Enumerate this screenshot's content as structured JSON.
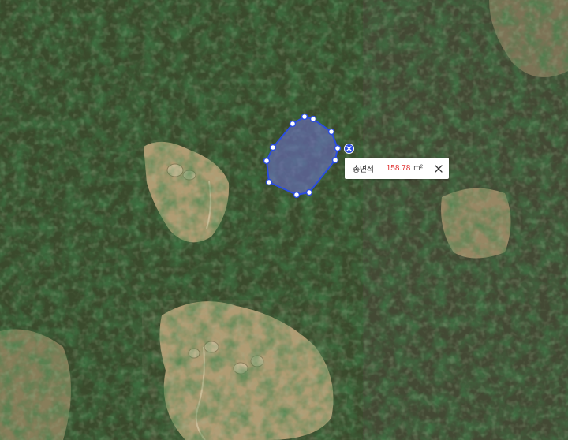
{
  "map": {
    "type": "satellite-imagery",
    "overlay": {
      "kind": "area-measurement-polygon",
      "stroke_color": "#2b4de0",
      "fill_color": "#6c6fc8",
      "vertex_count": 11
    }
  },
  "measurement": {
    "label": "총면적",
    "value": "158.78",
    "unit": "m²",
    "value_color": "#e03030"
  },
  "icons": {
    "close": "close-icon",
    "remove_shape": "remove-shape-icon"
  }
}
